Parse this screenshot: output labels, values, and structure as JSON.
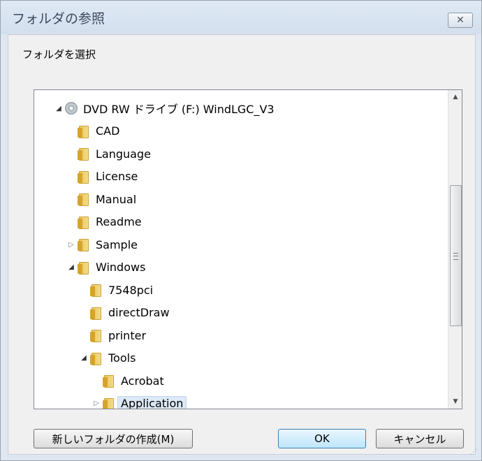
{
  "window": {
    "title": "フォルダの参照",
    "close_label": "✕"
  },
  "prompt": "フォルダを選択",
  "tree": [
    {
      "label": "DVD RW ドライブ (F:) WindLGC_V3",
      "icon": "disc-drive-icon",
      "expander": "expanded",
      "level": 0
    },
    {
      "label": "CAD",
      "icon": "folder-icon",
      "expander": "none",
      "level": 1
    },
    {
      "label": "Language",
      "icon": "folder-icon",
      "expander": "none",
      "level": 1
    },
    {
      "label": "License",
      "icon": "folder-icon",
      "expander": "none",
      "level": 1
    },
    {
      "label": "Manual",
      "icon": "folder-icon",
      "expander": "none",
      "level": 1
    },
    {
      "label": "Readme",
      "icon": "folder-icon",
      "expander": "none",
      "level": 1
    },
    {
      "label": "Sample",
      "icon": "folder-icon",
      "expander": "collapsed",
      "level": 1
    },
    {
      "label": "Windows",
      "icon": "folder-icon",
      "expander": "expanded",
      "level": 1
    },
    {
      "label": "7548pci",
      "icon": "folder-icon",
      "expander": "none",
      "level": 2
    },
    {
      "label": "directDraw",
      "icon": "folder-icon",
      "expander": "none",
      "level": 2
    },
    {
      "label": "printer",
      "icon": "folder-icon",
      "expander": "none",
      "level": 2
    },
    {
      "label": "Tools",
      "icon": "folder-icon",
      "expander": "expanded",
      "level": 2
    },
    {
      "label": "Acrobat",
      "icon": "folder-icon",
      "expander": "none",
      "level": 3
    },
    {
      "label": "Application",
      "icon": "folder-icon",
      "expander": "collapsed",
      "level": 3,
      "selected": true
    }
  ],
  "buttons": {
    "new_folder": "新しいフォルダの作成(M)",
    "ok": "OK",
    "cancel": "キャンセル"
  },
  "colors": {
    "window_frame": "#dfe8f2",
    "selection": "#dce9f6",
    "ok_button": "#bee6fd"
  }
}
